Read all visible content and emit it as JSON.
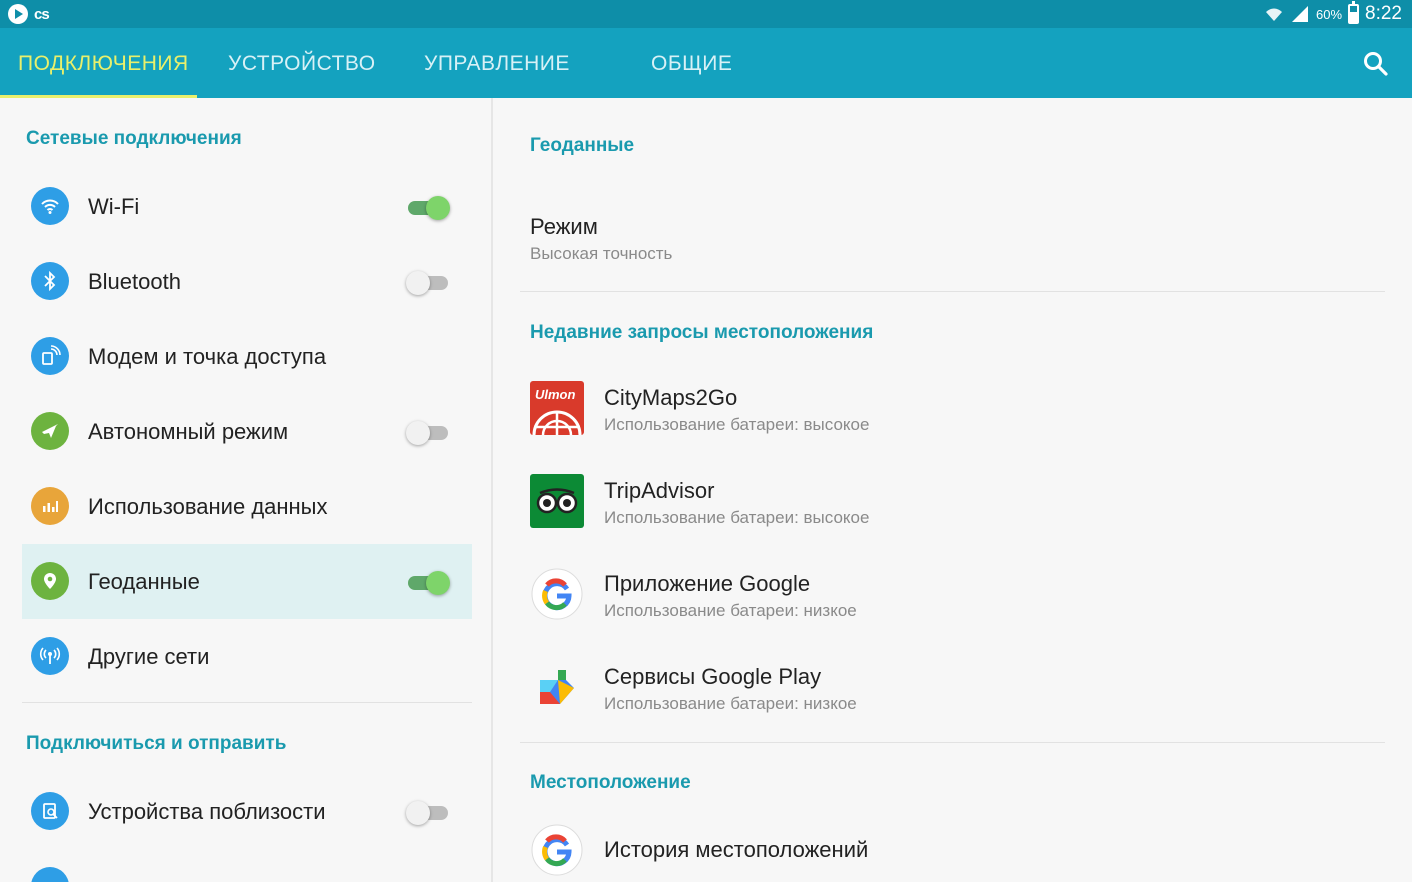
{
  "status_bar": {
    "left_text": "cs",
    "battery_percent": "60%",
    "battery_level": 0.6,
    "time": "8:22"
  },
  "tabs": [
    {
      "label": "ПОДКЛЮЧЕНИЯ",
      "active": true
    },
    {
      "label": "УСТРОЙСТВО",
      "active": false
    },
    {
      "label": "УПРАВЛЕНИЕ",
      "active": false
    },
    {
      "label": "ОБЩИЕ",
      "active": false
    }
  ],
  "left": {
    "section1_title": "Сетевые подключения",
    "items": [
      {
        "label": "Wi-Fi",
        "icon": "wifi-icon",
        "color": "#2e9ee6",
        "toggle": "on"
      },
      {
        "label": "Bluetooth",
        "icon": "bluetooth-icon",
        "color": "#2e9ee6",
        "toggle": "off"
      },
      {
        "label": "Модем и точка доступа",
        "icon": "hotspot-icon",
        "color": "#2e9ee6",
        "toggle": "none"
      },
      {
        "label": "Автономный режим",
        "icon": "airplane-icon",
        "color": "#6db33f",
        "toggle": "off"
      },
      {
        "label": "Использование данных",
        "icon": "data-usage-icon",
        "color": "#e8a53a",
        "toggle": "none"
      },
      {
        "label": "Геоданные",
        "icon": "location-icon",
        "color": "#6db33f",
        "toggle": "on",
        "selected": true
      },
      {
        "label": "Другие сети",
        "icon": "other-networks-icon",
        "color": "#2e9ee6",
        "toggle": "none"
      }
    ],
    "section2_title": "Подключиться и отправить",
    "items2": [
      {
        "label": "Устройства поблизости",
        "icon": "nearby-devices-icon",
        "color": "#2e9ee6",
        "toggle": "off"
      }
    ]
  },
  "right": {
    "section1_title": "Геоданные",
    "mode": {
      "title": "Режим",
      "subtitle": "Высокая точность"
    },
    "section2_title": "Недавние запросы местоположения",
    "apps": [
      {
        "name": "CityMaps2Go",
        "sub": "Использование батареи: высокое",
        "icon": "citymaps-icon",
        "icon_text": "Ulmon"
      },
      {
        "name": "TripAdvisor",
        "sub": "Использование батареи: высокое",
        "icon": "tripadvisor-icon"
      },
      {
        "name": "Приложение Google",
        "sub": "Использование батареи: низкое",
        "icon": "google-icon"
      },
      {
        "name": "Сервисы Google Play",
        "sub": "Использование батареи: низкое",
        "icon": "google-play-services-icon"
      }
    ],
    "section3_title": "Местоположение",
    "history": {
      "title": "История местоположений",
      "icon": "google-icon"
    }
  },
  "colors": {
    "status_bar": "#0e8ea8",
    "tab_bar": "#14a2bf",
    "active_tab": "#e9f06b",
    "section_title": "#1a9aae",
    "selected_row": "#dff1f2"
  }
}
